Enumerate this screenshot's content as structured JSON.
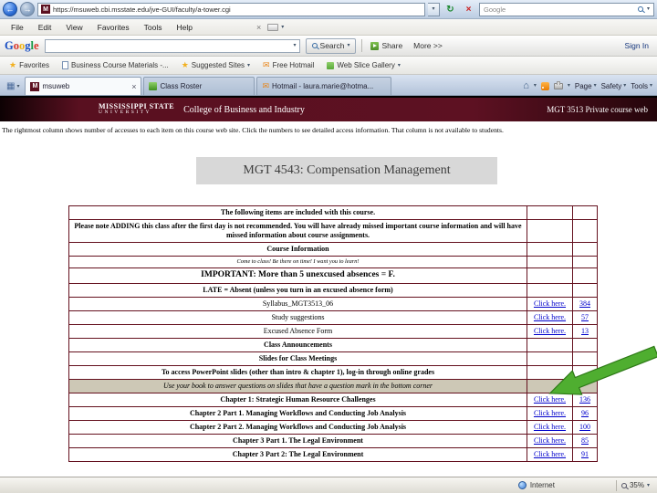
{
  "colors": {
    "maroon": "#5c1020",
    "link_blue": "#0000cc",
    "arrow_green": "#4fae30",
    "title_box_bg": "#d8d8d8"
  },
  "icons": {
    "back": "←",
    "forward": "→",
    "refresh": "↻",
    "stop": "×",
    "close": "×",
    "dropdown": "▾",
    "star": "★",
    "envelope": "✉",
    "house": "⌂",
    "grid": "▦",
    "favicon_letter": "M"
  },
  "browser": {
    "address_url": "https://msuweb.cbi.msstate.edu/jve-GUI/faculty/a-tower.cgi",
    "search_box_text": "Google",
    "menu": [
      "File",
      "Edit",
      "View",
      "Favorites",
      "Tools",
      "Help"
    ],
    "google_toolbar": {
      "logo_letters": [
        "G",
        "o",
        "o",
        "g",
        "l",
        "e"
      ],
      "search_button": "Search",
      "share": "Share",
      "more": "More >>",
      "sign_in": "Sign In"
    },
    "favorites_bar": {
      "label": "Favorites",
      "items": [
        {
          "label": "Business Course Materials -..."
        },
        {
          "label": "Suggested Sites"
        },
        {
          "label": "Free Hotmail"
        },
        {
          "label": "Web Slice Gallery"
        }
      ]
    },
    "tabs": [
      {
        "label": "msuweb"
      },
      {
        "label": "Class Roster"
      },
      {
        "label": "Hotmail - laura.marie@hotma..."
      }
    ],
    "command_bar": [
      "Page",
      "Safety",
      "Tools"
    ],
    "status_bar": {
      "zone": "Internet",
      "zoom": "35%"
    }
  },
  "banner": {
    "logo_line1": "MISSISSIPPI STATE",
    "logo_line2": "UNIVERSITY",
    "college": "College of Business and Industry",
    "course": "MGT 3513 Private course web"
  },
  "notice": "The rightmost column shows number of accesses to each item on this course web site. Click the numbers to see detailed access information. That column is not available to students.",
  "slide_title": "MGT 4543: Compensation Management",
  "table": {
    "rows": [
      {
        "text": "The following items are included with this course.",
        "style": "bold"
      },
      {
        "text": "Please note ADDING this class after the first day is not recommended. You will have already missed important course information and will have missed information about course assignments.",
        "style": "bold"
      },
      {
        "text": "Course Information",
        "style": "bold"
      },
      {
        "text": "Come to class! Be there on time! I want you to learn!",
        "style": "small-italic"
      },
      {
        "text": "IMPORTANT: More than 5 unexcused absences = F.",
        "style": "important"
      },
      {
        "text": "LATE = Absent (unless you turn in an excused absence form)",
        "style": "bold"
      },
      {
        "text": "Syllabus_MGT3513_06",
        "style": "normal",
        "link": "Click here.",
        "count": "384"
      },
      {
        "text": "Study suggestions",
        "style": "normal",
        "link": "Click here.",
        "count": "57"
      },
      {
        "text": "Excused Absence Form",
        "style": "normal",
        "link": "Click here.",
        "count": "13"
      },
      {
        "text": "Class Announcements",
        "style": "bold"
      },
      {
        "text": "Slides for Class Meetings",
        "style": "bold"
      },
      {
        "text": "To access PowerPoint slides (other than intro & chapter 1), log-in through online grades",
        "style": "bold"
      },
      {
        "text": "Use your book to answer questions on slides that have a question mark in the bottom corner",
        "style": "italic",
        "highlight": true
      },
      {
        "text": "Chapter 1: Strategic Human Resource Challenges",
        "style": "bold",
        "link": "Click here.",
        "count": "136"
      },
      {
        "text": "Chapter 2 Part 1. Managing Workflows and Conducting Job Analysis",
        "style": "bold",
        "link": "Click here.",
        "count": "96"
      },
      {
        "text": "Chapter 2 Part 2. Managing Workflows and Conducting Job Analysis",
        "style": "bold",
        "link": "Click here.",
        "count": "100"
      },
      {
        "text": "Chapter 3 Part 1. The Legal Environment",
        "style": "bold",
        "link": "Click here.",
        "count": "85"
      },
      {
        "text": "Chapter 3 Part 2: The Legal Environment",
        "style": "bold",
        "link": "Click here.",
        "count": "91"
      }
    ]
  }
}
